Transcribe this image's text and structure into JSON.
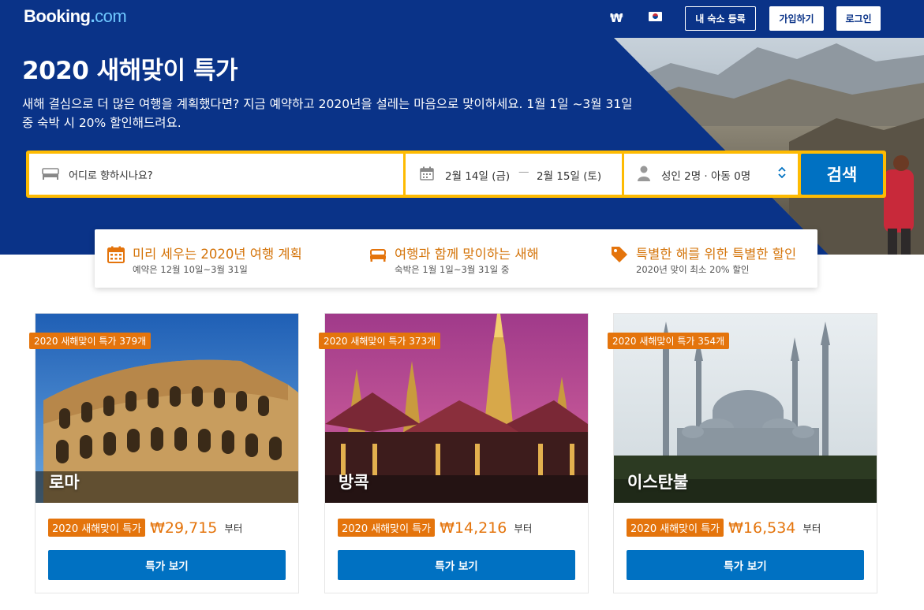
{
  "header": {
    "logo_main": "Booking",
    "logo_dot": ".",
    "logo_com": "com",
    "currency": "₩",
    "flag_icon": "kr-flag-icon",
    "list_property": "내 숙소 등록",
    "register": "가입하기",
    "sign_in": "로그인"
  },
  "hero": {
    "title": "2020 새해맞이 특가",
    "subtitle": "새해 결심으로 더 많은 여행을 계획했다면? 지금 예약하고 2020년을 설레는 마음으로 맞이하세요. 1월 1일 ~3월 31일 중 숙박 시 20% 할인해드려요."
  },
  "search": {
    "destination_placeholder": "어디로 향하시나요?",
    "checkin": "2월 14일 (금)",
    "date_separator": "—",
    "checkout": "2월 15일 (토)",
    "guests": "성인 2명 · 아동 0명",
    "search_button": "검색"
  },
  "perks": [
    {
      "title": "미리 세우는 2020년 여행 계획",
      "subtitle": "예약은 12월 10일~3월 31일",
      "icon": "calendar-icon"
    },
    {
      "title": "여행과 함께 맞이하는 새해",
      "subtitle": "숙박은 1월 1일~3월 31일 중",
      "icon": "bed-icon"
    },
    {
      "title": "특별한 해를 위한 특별한 할인",
      "subtitle": "2020년 맞이 최소 20% 할인",
      "icon": "tag-icon"
    }
  ],
  "cards": [
    {
      "badge": "2020 새해맞이 특가 379개",
      "city": "로마",
      "deal_label": "2020 새해맞이 특가",
      "price": "₩29,715",
      "from": "부터",
      "button": "특가 보기"
    },
    {
      "badge": "2020 새해맞이 특가 373개",
      "city": "방콕",
      "deal_label": "2020 새해맞이 특가",
      "price": "₩14,216",
      "from": "부터",
      "button": "특가 보기"
    },
    {
      "badge": "2020 새해맞이 특가 354개",
      "city": "이스탄불",
      "deal_label": "2020 새해맞이 특가",
      "price": "₩16,534",
      "from": "부터",
      "button": "특가 보기"
    }
  ],
  "colors": {
    "brand_blue": "#0a3388",
    "action_blue": "#0071c2",
    "search_border": "#febb02",
    "deal_orange": "#e4740c"
  }
}
